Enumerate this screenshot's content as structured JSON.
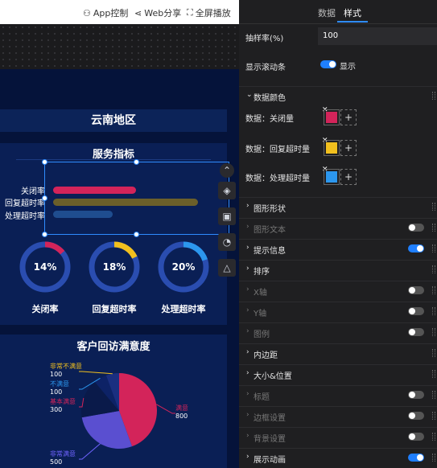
{
  "toolbar": {
    "app_control": "App控制",
    "web_share": "Web分享",
    "fullscreen": "全屏播放"
  },
  "canvas": {
    "region_title": "云南地区",
    "service_panel": {
      "title": "服务指标",
      "bars": [
        {
          "label": "关闭率",
          "value": 0.5,
          "color": "#d3245a"
        },
        {
          "label": "回复超时率",
          "value": 0.88,
          "color": "#6b5f2a"
        },
        {
          "label": "处理超时率",
          "value": 0.36,
          "color": "#1f4d8f"
        }
      ],
      "gauges": [
        {
          "label": "关闭率",
          "value_text": "14%",
          "value": 0.14,
          "color": "#d3245a"
        },
        {
          "label": "回复超时率",
          "value_text": "18%",
          "value": 0.18,
          "color": "#f2c01e"
        },
        {
          "label": "处理超时率",
          "value_text": "20%",
          "value": 0.2,
          "color": "#2c97ee"
        }
      ]
    },
    "satisfaction_panel": {
      "title": "客户回访满意度"
    }
  },
  "chart_data": {
    "type": "pie",
    "title": "客户回访满意度",
    "slices": [
      {
        "name": "满意",
        "value": 800,
        "color": "#d3245a"
      },
      {
        "name": "非常满意",
        "value": 500,
        "color": "#5a4fd0"
      },
      {
        "name": "基本满意",
        "value": 300,
        "color": "#0a1a4a"
      },
      {
        "name": "不满意",
        "value": 100,
        "color": "#0d2266"
      },
      {
        "name": "非常不满意",
        "value": 100,
        "color": "#1a2f80"
      }
    ],
    "label_colors": {
      "满意": "#d3245a",
      "非常满意": "#6f63ff",
      "基本满意": "#d3245a",
      "不满意": "#2c97ee",
      "非常不满意": "#f2c01e"
    }
  },
  "right_panel": {
    "tabs": [
      "数据",
      "样式"
    ],
    "active_tab": "样式",
    "sample_rate": {
      "label": "抽样率(%)",
      "value": "100"
    },
    "show_scrollbar": {
      "label": "显示滚动条",
      "value_label": "显示",
      "on": true
    },
    "data_colors": {
      "title": "数据颜色",
      "items": [
        {
          "label": "数据：关闭量",
          "color": "#d3245a"
        },
        {
          "label": "数据：回复超时量",
          "color": "#f2c01e"
        },
        {
          "label": "数据：处理超时量",
          "color": "#2c97ee"
        }
      ]
    },
    "sections": [
      {
        "title": "图形形状",
        "enabled": true,
        "toggle": null
      },
      {
        "title": "图形文本",
        "enabled": false,
        "toggle": "off"
      },
      {
        "title": "提示信息",
        "enabled": true,
        "toggle": "on"
      },
      {
        "title": "排序",
        "enabled": true,
        "toggle": null
      },
      {
        "title": "X轴",
        "enabled": false,
        "toggle": "off"
      },
      {
        "title": "Y轴",
        "enabled": false,
        "toggle": "off"
      },
      {
        "title": "图例",
        "enabled": false,
        "toggle": "off"
      },
      {
        "title": "内边距",
        "enabled": true,
        "toggle": null
      },
      {
        "title": "大小&位置",
        "enabled": true,
        "toggle": null
      },
      {
        "title": "标题",
        "enabled": false,
        "toggle": "off"
      },
      {
        "title": "边框设置",
        "enabled": false,
        "toggle": "off"
      },
      {
        "title": "背景设置",
        "enabled": false,
        "toggle": "off"
      },
      {
        "title": "展示动画",
        "enabled": true,
        "toggle": "on"
      }
    ]
  }
}
